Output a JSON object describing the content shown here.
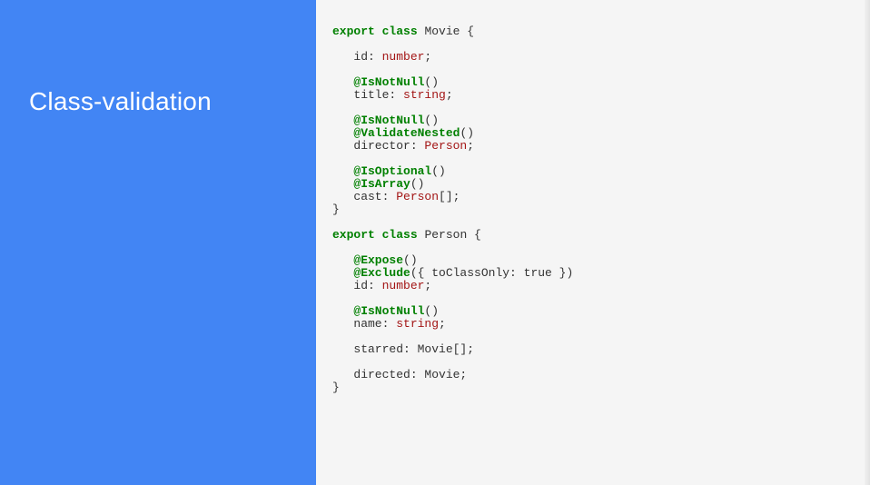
{
  "sidebar": {
    "title": "Class-validation"
  },
  "code": {
    "l1_export": "export",
    "l1_class": "class",
    "l1_rest": " Movie {",
    "l2": "",
    "l3_pre": "   id: ",
    "l3_type": "number",
    "l3_post": ";",
    "l4": "",
    "l5_dec": "   @IsNotNull",
    "l5_post": "()",
    "l6_pre": "   title: ",
    "l6_type": "string",
    "l6_post": ";",
    "l7": "",
    "l8_dec": "   @IsNotNull",
    "l8_post": "()",
    "l9_dec": "   @ValidateNested",
    "l9_post": "()",
    "l10_pre": "   director: ",
    "l10_type": "Person",
    "l10_post": ";",
    "l11": "",
    "l12_dec": "   @IsOptional",
    "l12_post": "()",
    "l13_dec": "   @IsArray",
    "l13_post": "()",
    "l14_pre": "   cast: ",
    "l14_type": "Person",
    "l14_post": "[];",
    "l15": "}",
    "l16": "",
    "l17_export": "export",
    "l17_class": "class",
    "l17_rest": " Person {",
    "l18": "",
    "l19_dec": "   @Expose",
    "l19_post": "()",
    "l20_dec": "   @Exclude",
    "l20_post": "({ toClassOnly: true })",
    "l21_pre": "   id: ",
    "l21_type": "number",
    "l21_post": ";",
    "l22": "",
    "l23_dec": "   @IsNotNull",
    "l23_post": "()",
    "l24_pre": "   name: ",
    "l24_type": "string",
    "l24_post": ";",
    "l25": "",
    "l26": "   starred: Movie[];",
    "l27": "",
    "l28": "   directed: Movie;",
    "l29": "}"
  }
}
